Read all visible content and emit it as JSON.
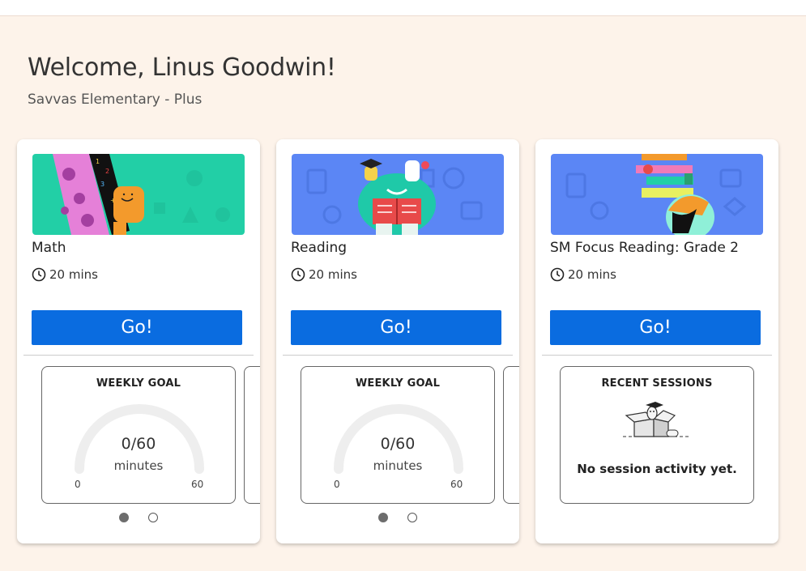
{
  "header": {
    "welcome": "Welcome, Linus Goodwin!",
    "school": "Savvas Elementary - Plus"
  },
  "colors": {
    "background": "#fdf3ea",
    "go_button": "#0a6ce0",
    "math_banner": "#22cfa6",
    "reading_banner": "#5b86f5"
  },
  "cards": [
    {
      "subject": "Math",
      "duration": "20 mins",
      "go_label": "Go!",
      "widget": {
        "title": "WEEKLY GOAL",
        "value": "0/60",
        "unit": "minutes",
        "min": "0",
        "max": "60",
        "progress": 0
      },
      "pagination": {
        "current": 1,
        "total": 2
      }
    },
    {
      "subject": "Reading",
      "duration": "20 mins",
      "go_label": "Go!",
      "widget": {
        "title": "WEEKLY GOAL",
        "value": "0/60",
        "unit": "minutes",
        "min": "0",
        "max": "60",
        "progress": 0
      },
      "pagination": {
        "current": 1,
        "total": 2
      }
    },
    {
      "subject": "SM Focus Reading: Grade 2",
      "duration": "20 mins",
      "go_label": "Go!",
      "widget": {
        "title": "RECENT SESSIONS",
        "message": "No session activity yet."
      }
    }
  ],
  "icons": {
    "duration": "clock-icon",
    "empty_sessions": "empty-box-illustration"
  }
}
